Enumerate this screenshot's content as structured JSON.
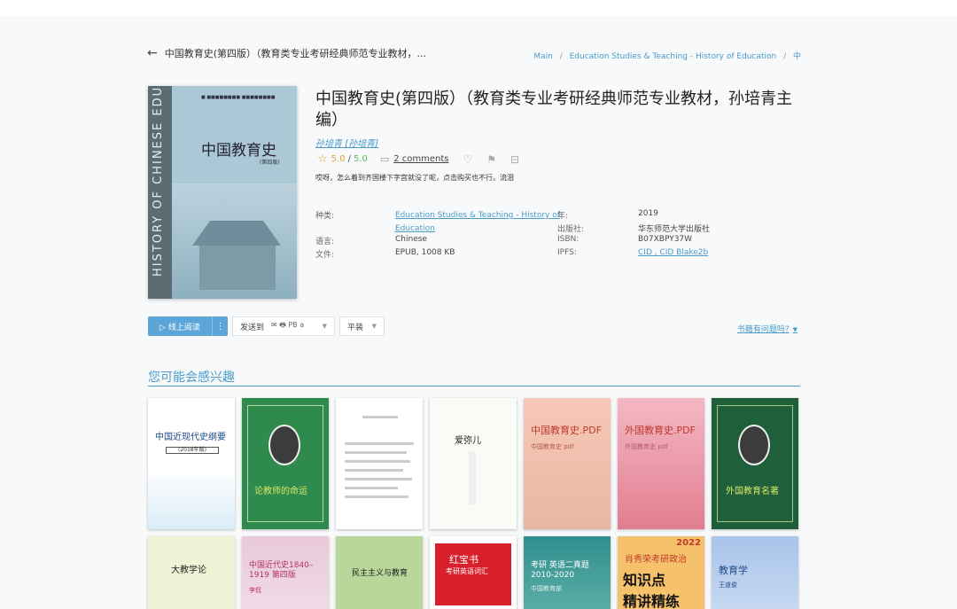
{
  "nav": {
    "back_title": "中国教育史(第四版）（教育类专业考研经典师范专业教材，...",
    "breadcrumb": [
      "Main",
      "Education Studies & Teaching - History of Education",
      "中"
    ]
  },
  "book": {
    "title": "中国教育史(第四版）（教育类专业考研经典师范专业教材，孙培青主编）",
    "author": "孙培青 [孙培青]",
    "rating": "5.0",
    "rating_max": "5.0",
    "comments": "2 comments",
    "review_snippet": "哎呀，怎么着到齐国楼下字宫就没了呢，点击购买也不行。流泪",
    "cover": {
      "vertical_text": "HISTORY OF CHINESE EDUCATION",
      "title": "中国教育史",
      "edition": "(第四版)"
    },
    "details": {
      "category_label": "种类:",
      "category_value": "Education Studies & Teaching - History of Education",
      "year_label": "年:",
      "year_value": "2019",
      "publisher_label": "出版社:",
      "publisher_value": "华东师范大学出版社",
      "language_label": "语言:",
      "language_value": "Chinese",
      "isbn_label": "ISBN:",
      "isbn_value": "B07XBPY37W",
      "file_label": "文件:",
      "file_value": "EPUB, 1008 KB",
      "ipfs_label": "IPFS:",
      "ipfs_value": "CID , CID Blake2b"
    }
  },
  "actions": {
    "read_online": "线上阅读",
    "send_to": "发送到",
    "send_formats": "✉ 🖶 PB a",
    "sort": "平装",
    "problem": "书籍有问题吗?"
  },
  "recommend": {
    "title": "您可能会感兴趣",
    "row1": [
      {
        "title": "中国近现代史纲要",
        "sub": "(2018年版)"
      },
      {
        "title": "",
        "sub": "论教师的命运"
      },
      {
        "title": "",
        "sub": ""
      },
      {
        "title": "爱弥儿",
        "sub": ""
      },
      {
        "title": "中国教育史.PDF",
        "sub": "中国教育史 pdf"
      },
      {
        "title": "外国教育史.PDF",
        "sub": "外国教育史 pdf"
      },
      {
        "title": "",
        "sub": "外国教育名著"
      }
    ],
    "row2": [
      {
        "title": "大教学论",
        "sub": ""
      },
      {
        "title": "中国近代史1840–1919 第四版",
        "sub": "李侃"
      },
      {
        "title": "民主主义与教育",
        "sub": ""
      },
      {
        "title": "红宝书",
        "sub": "考研英语词汇"
      },
      {
        "title": "考研 英语二真题 2010-2020",
        "sub": "中国教育部"
      },
      {
        "title": "肖秀荣考研政治",
        "sub": "知识点",
        "extra": "精讲精练",
        "year": "2022"
      },
      {
        "title": "教育学",
        "sub": "王道俊"
      }
    ]
  },
  "colors": {
    "accent": "#4a9bc9",
    "rating": "#e6a23c",
    "rating_max": "#5fb85f",
    "button": "#5ba6d6"
  }
}
